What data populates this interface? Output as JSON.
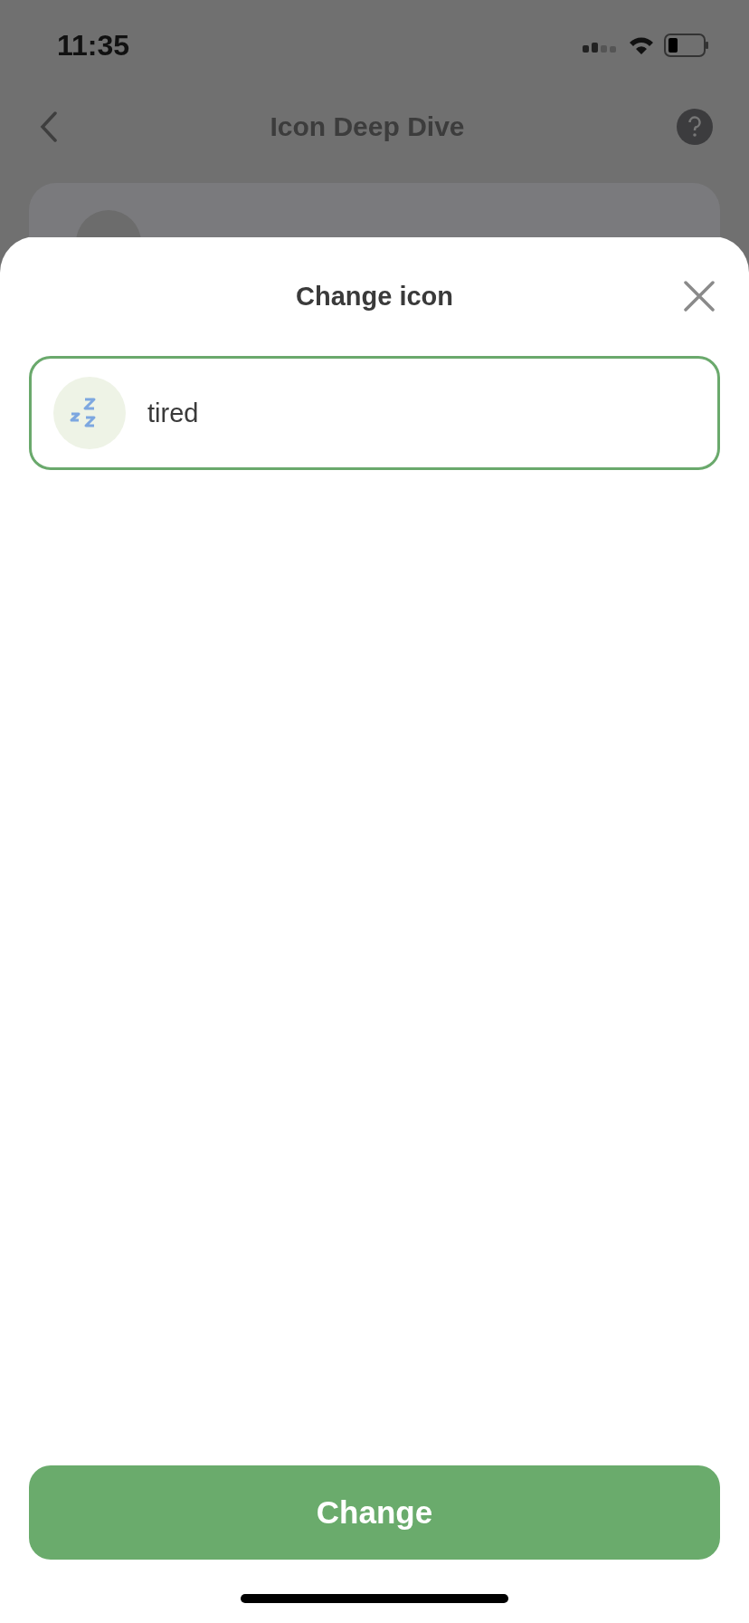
{
  "status_bar": {
    "time": "11:35"
  },
  "nav": {
    "title": "Icon Deep Dive"
  },
  "sheet": {
    "title": "Change icon",
    "options": [
      {
        "label": "tired",
        "selected": true
      }
    ],
    "button": "Change"
  }
}
